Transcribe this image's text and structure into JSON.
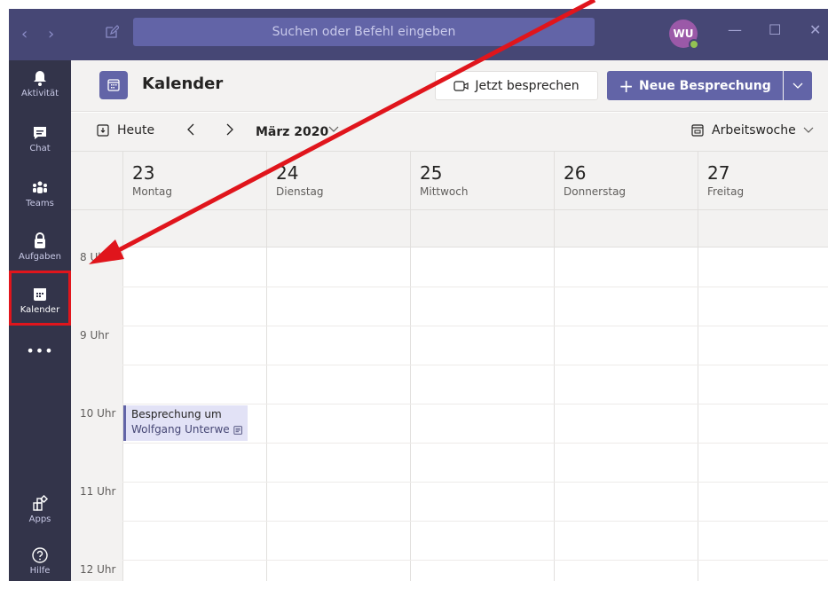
{
  "titlebar": {
    "search_placeholder": "Suchen oder Befehl eingeben",
    "avatar_initials": "WU",
    "minimize": "—",
    "maximize": "☐",
    "close": "✕"
  },
  "rail": {
    "items": [
      {
        "label": "Aktivität"
      },
      {
        "label": "Chat"
      },
      {
        "label": "Teams"
      },
      {
        "label": "Aufgaben"
      },
      {
        "label": "Kalender"
      },
      {
        "label": "Apps"
      },
      {
        "label": "Hilfe"
      }
    ],
    "more": "•••"
  },
  "header": {
    "title": "Kalender",
    "meet_now": "Jetzt besprechen",
    "new_meeting": "Neue Besprechung"
  },
  "toolbar": {
    "today": "Heute",
    "month": "März 2020",
    "view": "Arbeitswoche"
  },
  "days": [
    {
      "num": "23",
      "name": "Montag"
    },
    {
      "num": "24",
      "name": "Dienstag"
    },
    {
      "num": "25",
      "name": "Mittwoch"
    },
    {
      "num": "26",
      "name": "Donnerstag"
    },
    {
      "num": "27",
      "name": "Freitag"
    }
  ],
  "hours": [
    "8 Uhr",
    "9 Uhr",
    "10 Uhr",
    "11 Uhr",
    "12 Uhr"
  ],
  "event": {
    "title": "Besprechung um",
    "organizer": "Wolfgang Unterwe"
  },
  "colors": {
    "brand": "#6264a7",
    "titlebar": "#464775",
    "rail": "#33344a",
    "highlight": "#e0151c",
    "event_bg": "#e2e2f6"
  }
}
